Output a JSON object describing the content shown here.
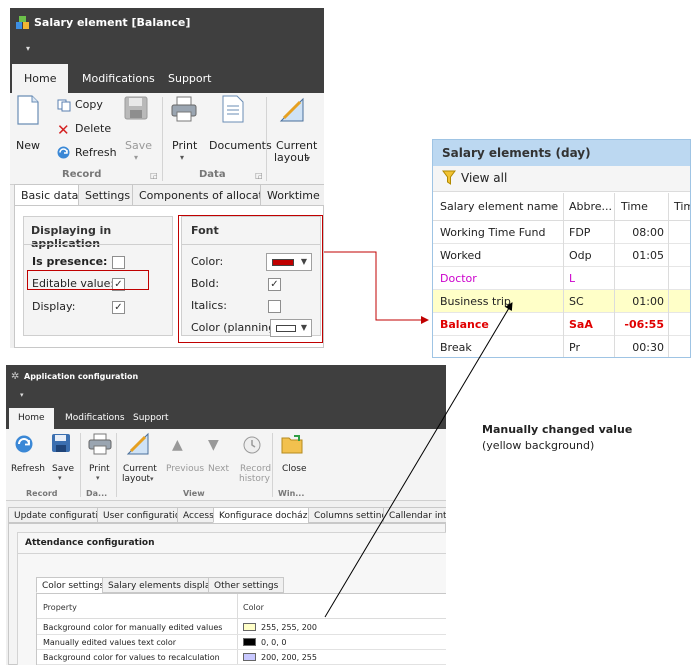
{
  "window1": {
    "title": "Salary element [Balance]",
    "ribbon_tabs": [
      "Home",
      "Modifications",
      "Support"
    ],
    "buttons": {
      "new": "New",
      "copy": "Copy",
      "delete": "Delete",
      "refresh": "Refresh",
      "save": "Save",
      "print": "Print",
      "documents": "Documents",
      "current_layout_1": "Current",
      "current_layout_2": "layout"
    },
    "group_labels": {
      "record": "Record",
      "data": "Data"
    },
    "sub_tabs": [
      "Basic data",
      "Settings",
      "Components of allocation",
      "Worktime mo"
    ],
    "displaying": {
      "title": "Displaying in application",
      "is_presence": "Is presence:",
      "editable_value": "Editable value:",
      "display": "Display:",
      "is_presence_checked": false,
      "editable_value_checked": true,
      "display_checked": true
    },
    "font": {
      "title": "Font",
      "color": "Color:",
      "bold": "Bold:",
      "italics": "Italics:",
      "color_planning": "Color (planning):",
      "color_value": "#c00000",
      "color_planning_value": "#ffffff",
      "bold_checked": true,
      "italics_checked": false
    }
  },
  "window2": {
    "title": "Salary elements (day)",
    "view_all": "View all",
    "columns": [
      "Salary element name",
      "Abbre...",
      "Time",
      "Tim"
    ],
    "rows": [
      {
        "name": "Working Time Fund",
        "abbr": "FDP",
        "time": "08:00",
        "color": "#222222",
        "bg": "#ffffff",
        "bold": false
      },
      {
        "name": "Worked",
        "abbr": "Odp",
        "time": "01:05",
        "color": "#222222",
        "bg": "#ffffff",
        "bold": false
      },
      {
        "name": "Doctor",
        "abbr": "L",
        "time": "",
        "color": "#cc00cc",
        "bg": "#ffffff",
        "bold": false
      },
      {
        "name": "Business trip",
        "abbr": "SC",
        "time": "01:00",
        "color": "#222222",
        "bg": "#ffffc8",
        "bold": false
      },
      {
        "name": "Balance",
        "abbr": "SaA",
        "time": "-06:55",
        "color": "#e00000",
        "bg": "#ffffff",
        "bold": true
      },
      {
        "name": "Break",
        "abbr": "Pr",
        "time": "00:30",
        "color": "#222222",
        "bg": "#ffffff",
        "bold": false
      }
    ]
  },
  "window3": {
    "title": "Application configuration",
    "ribbon_tabs": [
      "Home",
      "Modifications",
      "Support"
    ],
    "buttons": {
      "refresh": "Refresh",
      "save": "Save",
      "print": "Print",
      "current_layout_1": "Current",
      "current_layout_2": "layout",
      "previous": "Previous",
      "next": "Next",
      "record_history_1": "Record",
      "record_history_2": "history",
      "close": "Close"
    },
    "group_labels": {
      "record": "Record",
      "data": "Da...",
      "view": "View",
      "window": "Win..."
    },
    "config_tabs": [
      "Update configuration",
      "User configuration",
      "Access",
      "Konfigurace docházky",
      "Columns settings",
      "Callendar interco"
    ],
    "section_title": "Attendance configuration",
    "inner_tabs": [
      "Color settings",
      "Salary elements displaying",
      "Other settings"
    ],
    "grid_headers": [
      "Property",
      "Color"
    ],
    "grid_rows": [
      {
        "property": "Background color for manually edited values",
        "value": "255, 255, 200",
        "swatch": "#ffffc8"
      },
      {
        "property": "Manually edited values text color",
        "value": "0, 0, 0",
        "swatch": "#000000"
      },
      {
        "property": "Background color for values to recalculation",
        "value": "200, 200, 255",
        "swatch": "#c8c8ff"
      }
    ]
  },
  "note": {
    "title": "Manually changed value",
    "subtitle": "(yellow background)"
  }
}
